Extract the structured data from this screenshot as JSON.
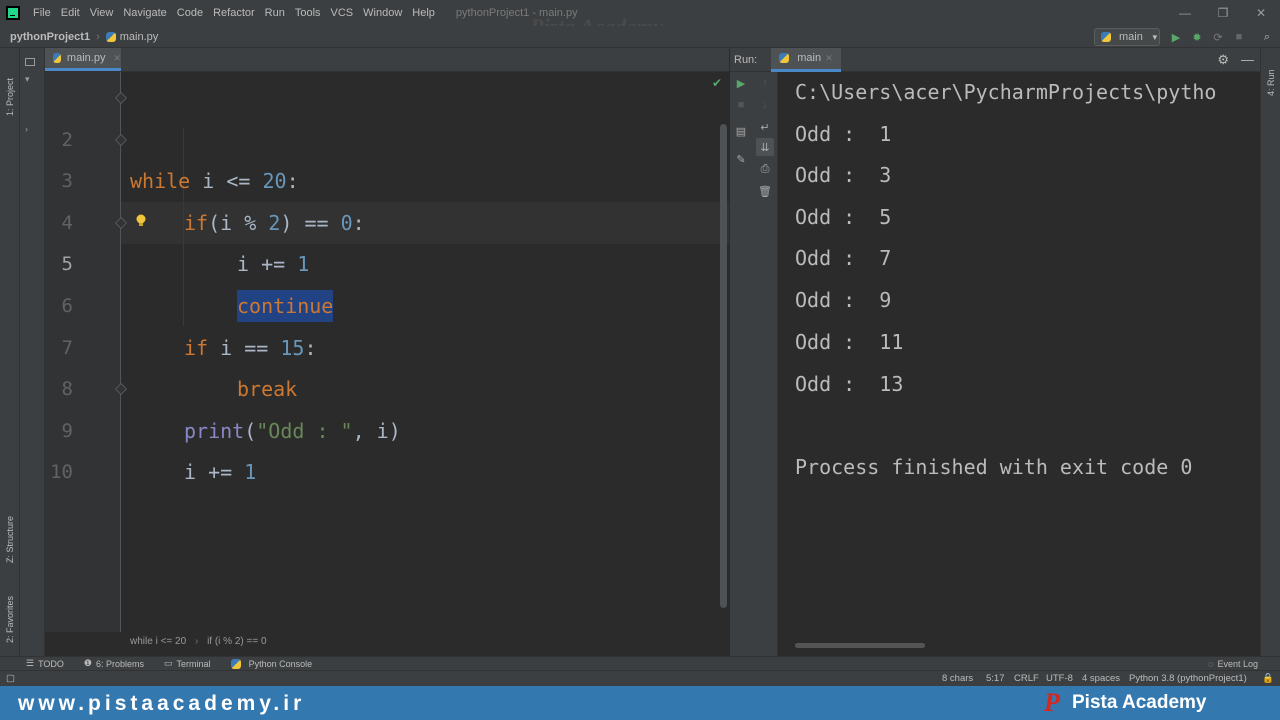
{
  "titlebar": {
    "menus": [
      "File",
      "Edit",
      "View",
      "Navigate",
      "Code",
      "Refactor",
      "Run",
      "Tools",
      "VCS",
      "Window",
      "Help"
    ],
    "title": "pythonProject1 - main.py",
    "watermark": "Pista Academy",
    "controls": {
      "minimize": "—",
      "maximize": "❐",
      "close": "✕"
    }
  },
  "navbar": {
    "project": "pythonProject1",
    "file": "main.py",
    "run_config": "main"
  },
  "left_strip": {
    "project": "1: Project",
    "structure": "Z: Structure",
    "favorites": "2: Favorites"
  },
  "right_strip": {
    "run": "4: Run"
  },
  "editor": {
    "tab": "main.py",
    "lines": [
      {
        "n": "2"
      },
      {
        "n": "3"
      },
      {
        "n": "4"
      },
      {
        "n": "5"
      },
      {
        "n": "6"
      },
      {
        "n": "7"
      },
      {
        "n": "8"
      },
      {
        "n": "9"
      },
      {
        "n": "10"
      }
    ],
    "code": {
      "l2": {
        "kw": "while",
        "a": " i <= ",
        "num": "20",
        "b": ":"
      },
      "l3": {
        "kw": "if",
        "a": "(i % ",
        "num": "2",
        "b": ") == ",
        "num2": "0",
        "c": ":"
      },
      "l4": {
        "a": "i += ",
        "num": "1"
      },
      "l5": {
        "kw": "continue"
      },
      "l6": {
        "kw": "if",
        "a": " i == ",
        "num": "15",
        "b": ":"
      },
      "l7": {
        "kw": "break"
      },
      "l8": {
        "fn": "print",
        "a": "(",
        "str": "\"Odd : \"",
        "b": ", i)"
      },
      "l9": {
        "a": "i += ",
        "num": "1"
      }
    },
    "breadcrumb": [
      "while i <= 20",
      "if (i % 2) == 0"
    ]
  },
  "run": {
    "label": "Run:",
    "tab": "main",
    "output": [
      "C:\\Users\\acer\\PycharmProjects\\pytho",
      "Odd :  1",
      "Odd :  3",
      "Odd :  5",
      "Odd :  7",
      "Odd :  9",
      "Odd :  11",
      "Odd :  13",
      "",
      "Process finished with exit code 0"
    ]
  },
  "tool_tabs": [
    "TODO",
    "6: Problems",
    "Terminal",
    "Python Console"
  ],
  "statusbar": {
    "chars": "8 chars",
    "position": "5:17",
    "line_sep": "CRLF",
    "encoding": "UTF-8",
    "indent": "4 spaces",
    "interpreter": "Python 3.8 (pythonProject1)",
    "event_log": "Event Log"
  },
  "banner": {
    "url": "www.pistaacademy.ir",
    "logo_text": "Pista Academy",
    "logo_mark": "P"
  },
  "colors": {
    "keyword": "#cc7832",
    "number": "#6897bb",
    "string": "#6a8759",
    "builtin": "#8888c6",
    "selection": "#214283",
    "accent": "#4a88c7"
  }
}
